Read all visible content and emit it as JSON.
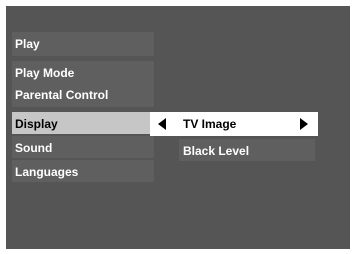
{
  "main_menu": {
    "items": [
      {
        "label": "Play"
      },
      {
        "label": "Play Mode"
      },
      {
        "label": "Parental Control"
      },
      {
        "label": "Display"
      },
      {
        "label": "Sound"
      },
      {
        "label": "Languages"
      }
    ],
    "selected_index": 3
  },
  "submenu": {
    "items": [
      {
        "label": "TV Image",
        "left_icon": "left-arrow-icon",
        "right_icon": "right-arrow-icon"
      },
      {
        "label": "Black Level"
      }
    ],
    "selected_index": 0
  },
  "colors": {
    "screen_bg": "#555555",
    "item_bg": "#5f5f5f",
    "selected_bg": "#c6c6c6",
    "highlight_bg": "#ffffff"
  }
}
